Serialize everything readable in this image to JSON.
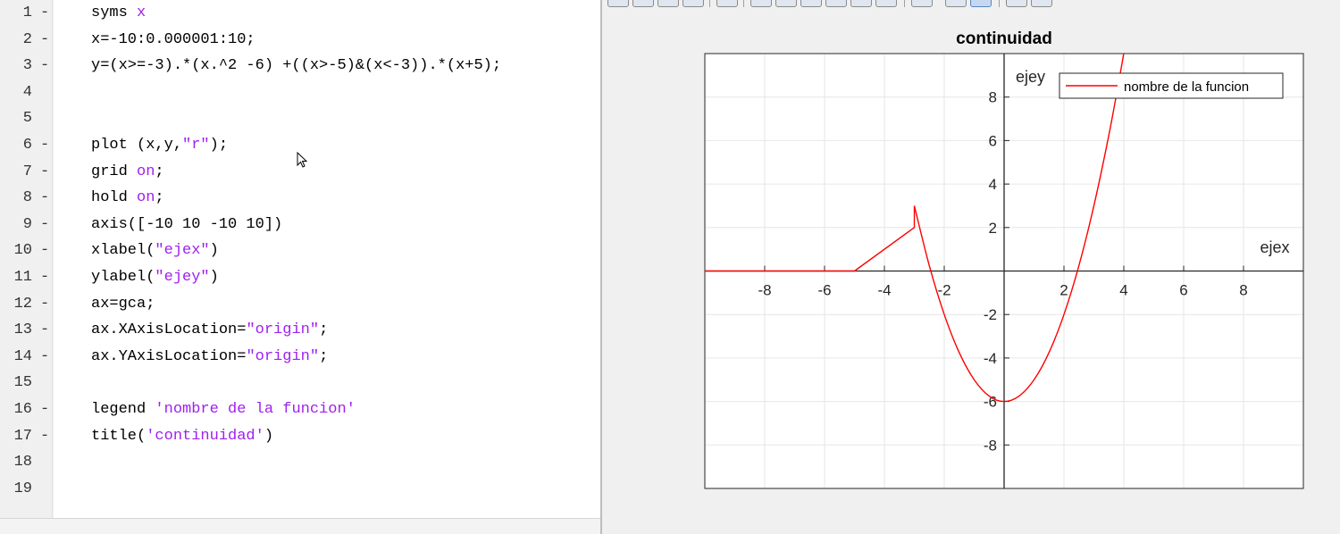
{
  "editor": {
    "lines": [
      {
        "n": "1",
        "mark": "-",
        "code": [
          {
            "t": "syms "
          },
          {
            "t": "x",
            "s": 1
          }
        ]
      },
      {
        "n": "2",
        "mark": "-",
        "code": [
          {
            "t": "x=-10:0.000001:10;"
          }
        ]
      },
      {
        "n": "3",
        "mark": "-",
        "code": [
          {
            "t": "y=(x>=-3).*(x.^2 -6) +((x>-5)&(x<-3)).*(x+5);"
          }
        ]
      },
      {
        "n": "4",
        "mark": "",
        "code": []
      },
      {
        "n": "5",
        "mark": "",
        "code": []
      },
      {
        "n": "6",
        "mark": "-",
        "code": [
          {
            "t": "plot (x,y,"
          },
          {
            "t": "\"r\"",
            "s": 1
          },
          {
            "t": ");"
          }
        ]
      },
      {
        "n": "7",
        "mark": "-",
        "code": [
          {
            "t": "grid "
          },
          {
            "t": "on",
            "s": 1
          },
          {
            "t": ";"
          }
        ]
      },
      {
        "n": "8",
        "mark": "-",
        "code": [
          {
            "t": "hold "
          },
          {
            "t": "on",
            "s": 1
          },
          {
            "t": ";"
          }
        ]
      },
      {
        "n": "9",
        "mark": "-",
        "code": [
          {
            "t": "axis([-10 10 -10 10])"
          }
        ]
      },
      {
        "n": "10",
        "mark": "-",
        "code": [
          {
            "t": "xlabel("
          },
          {
            "t": "\"ejex\"",
            "s": 1
          },
          {
            "t": ")"
          }
        ]
      },
      {
        "n": "11",
        "mark": "-",
        "code": [
          {
            "t": "ylabel("
          },
          {
            "t": "\"ejey\"",
            "s": 1
          },
          {
            "t": ")"
          }
        ]
      },
      {
        "n": "12",
        "mark": "-",
        "code": [
          {
            "t": "ax=gca;"
          }
        ]
      },
      {
        "n": "13",
        "mark": "-",
        "code": [
          {
            "t": "ax.XAxisLocation="
          },
          {
            "t": "\"origin\"",
            "s": 1
          },
          {
            "t": ";"
          }
        ]
      },
      {
        "n": "14",
        "mark": "-",
        "code": [
          {
            "t": "ax.YAxisLocation="
          },
          {
            "t": "\"origin\"",
            "s": 1
          },
          {
            "t": ";"
          }
        ]
      },
      {
        "n": "15",
        "mark": "",
        "code": []
      },
      {
        "n": "16",
        "mark": "-",
        "code": [
          {
            "t": "legend "
          },
          {
            "t": "'nombre de la funcion'",
            "s": 1
          }
        ]
      },
      {
        "n": "17",
        "mark": "-",
        "code": [
          {
            "t": "title("
          },
          {
            "t": "'continuidad'",
            "s": 1
          },
          {
            "t": ")"
          }
        ]
      },
      {
        "n": "18",
        "mark": "",
        "code": []
      },
      {
        "n": "19",
        "mark": "",
        "code": []
      }
    ]
  },
  "colors": {
    "string": "#a020f0",
    "line": "#ff0000",
    "grid": "#e6e6e6",
    "axis": "#262626"
  },
  "chart_data": {
    "type": "line",
    "title": "continuidad",
    "xlabel": "ejex",
    "ylabel": "ejey",
    "xlim": [
      -10,
      10
    ],
    "ylim": [
      -10,
      10
    ],
    "visible_xlim": [
      -10,
      10
    ],
    "visible_ylim": [
      -10,
      10
    ],
    "xticks": [
      -8,
      -6,
      -4,
      -2,
      2,
      4,
      6,
      8
    ],
    "xtick_labels": [
      "-8",
      "-6",
      "-4",
      "-2",
      "2",
      "4",
      "6",
      "8"
    ],
    "yticks": [
      -8,
      -6,
      -4,
      -2,
      2,
      4,
      6,
      8
    ],
    "ytick_labels": [
      "-8",
      "-6",
      "-4",
      "-2",
      "2",
      "4",
      "6",
      "8"
    ],
    "grid": true,
    "axis_location": "origin",
    "legend_position": "top-right",
    "series": [
      {
        "name": "nombre de la funcion",
        "color": "#ff0000",
        "x": [
          -10,
          -5,
          -3,
          -3,
          -2.5,
          -2,
          -1.5,
          -1,
          -0.5,
          0,
          0.5,
          1,
          1.5,
          2,
          2.5,
          3,
          3.5,
          3.87
        ],
        "y": [
          0,
          0,
          2,
          3,
          0.25,
          -2,
          -3.75,
          -5,
          -5.75,
          -6,
          -5.75,
          -5,
          -3.75,
          -2,
          0.25,
          3,
          6.25,
          9
        ]
      }
    ]
  }
}
